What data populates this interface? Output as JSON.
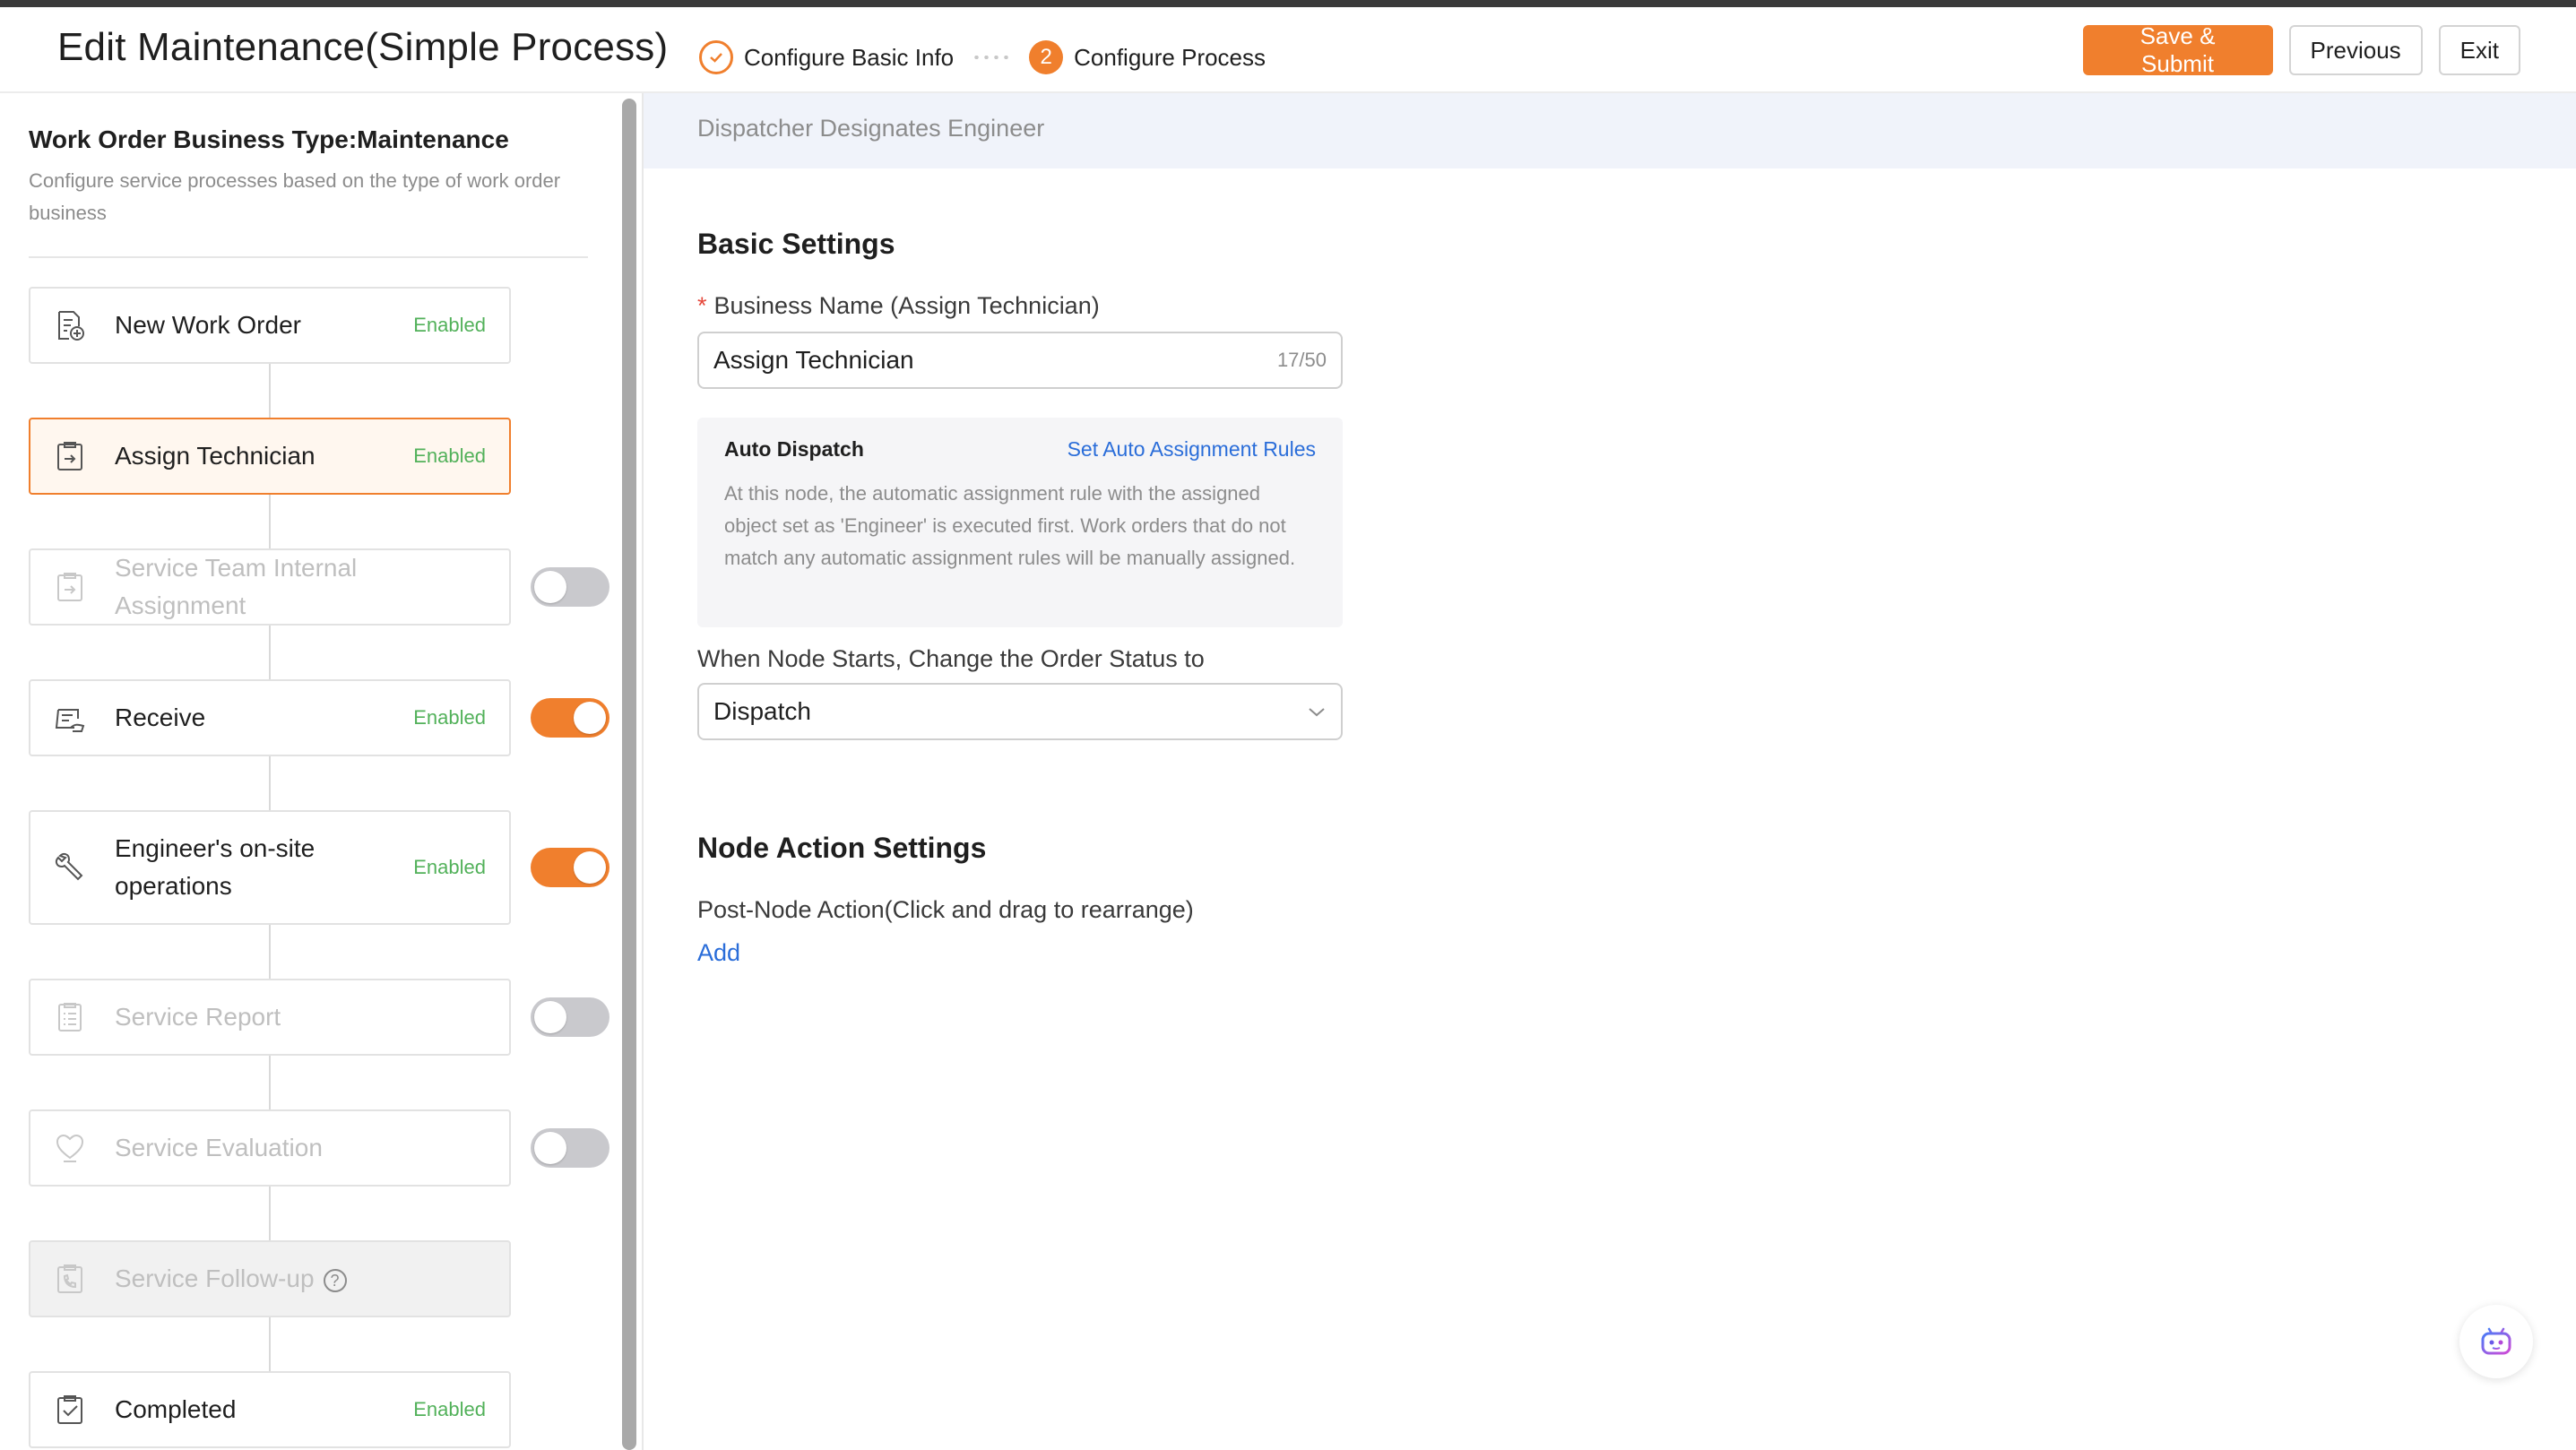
{
  "header": {
    "title": "Edit Maintenance(Simple Process)",
    "steps": [
      {
        "label": "Configure Basic Info",
        "state": "done"
      },
      {
        "label": "Configure Process",
        "number": "2",
        "state": "current"
      }
    ],
    "buttons": {
      "save_submit": "Save & Submit",
      "previous": "Previous",
      "exit": "Exit"
    }
  },
  "sidebar": {
    "title": "Work Order Business Type:Maintenance",
    "description": "Configure service processes based on the type of work order business",
    "nodes": [
      {
        "label": "New Work Order",
        "status": "Enabled",
        "icon": "new-order-icon",
        "enabled": true
      },
      {
        "label": "Assign Technician",
        "status": "Enabled",
        "icon": "assign-icon",
        "enabled": true,
        "active": true
      },
      {
        "label": "Service Team Internal Assignment",
        "status": "",
        "icon": "team-assign-icon",
        "enabled": false,
        "toggle": false
      },
      {
        "label": "Receive",
        "status": "Enabled",
        "icon": "receive-icon",
        "enabled": true,
        "toggle": true
      },
      {
        "label": "Engineer's on-site operations",
        "status": "Enabled",
        "icon": "wrench-icon",
        "enabled": true,
        "toggle": true
      },
      {
        "label": "Service Report",
        "status": "",
        "icon": "report-icon",
        "enabled": false,
        "toggle": false
      },
      {
        "label": "Service Evaluation",
        "status": "",
        "icon": "evaluation-icon",
        "enabled": false,
        "toggle": false
      },
      {
        "label": "Service Follow-up",
        "status": "",
        "icon": "phone-icon",
        "enabled": false,
        "help": "?"
      },
      {
        "label": "Completed",
        "status": "Enabled",
        "icon": "completed-icon",
        "enabled": true
      }
    ]
  },
  "main": {
    "node_header": "Dispatcher Designates Engineer",
    "basic_settings": {
      "title": "Basic Settings",
      "business_name_label": "Business Name (Assign Technician)",
      "required_mark": "*",
      "business_name_value": "Assign Technician",
      "business_name_count": "17/50",
      "auto_dispatch": {
        "title": "Auto Dispatch",
        "link": "Set Auto Assignment Rules",
        "text": "At this node, the automatic assignment rule with the assigned object set as 'Engineer' is executed first. Work orders that do not match any automatic assignment rules will be manually assigned."
      },
      "status_label": "When Node Starts, Change the Order Status to",
      "status_value": "Dispatch"
    },
    "node_action": {
      "title": "Node Action Settings",
      "post_label": "Post-Node Action(Click and drag to rearrange)",
      "add": "Add"
    }
  },
  "colors": {
    "accent": "#f07f2d",
    "enabled": "#52b15a",
    "link": "#2a6dd9"
  }
}
